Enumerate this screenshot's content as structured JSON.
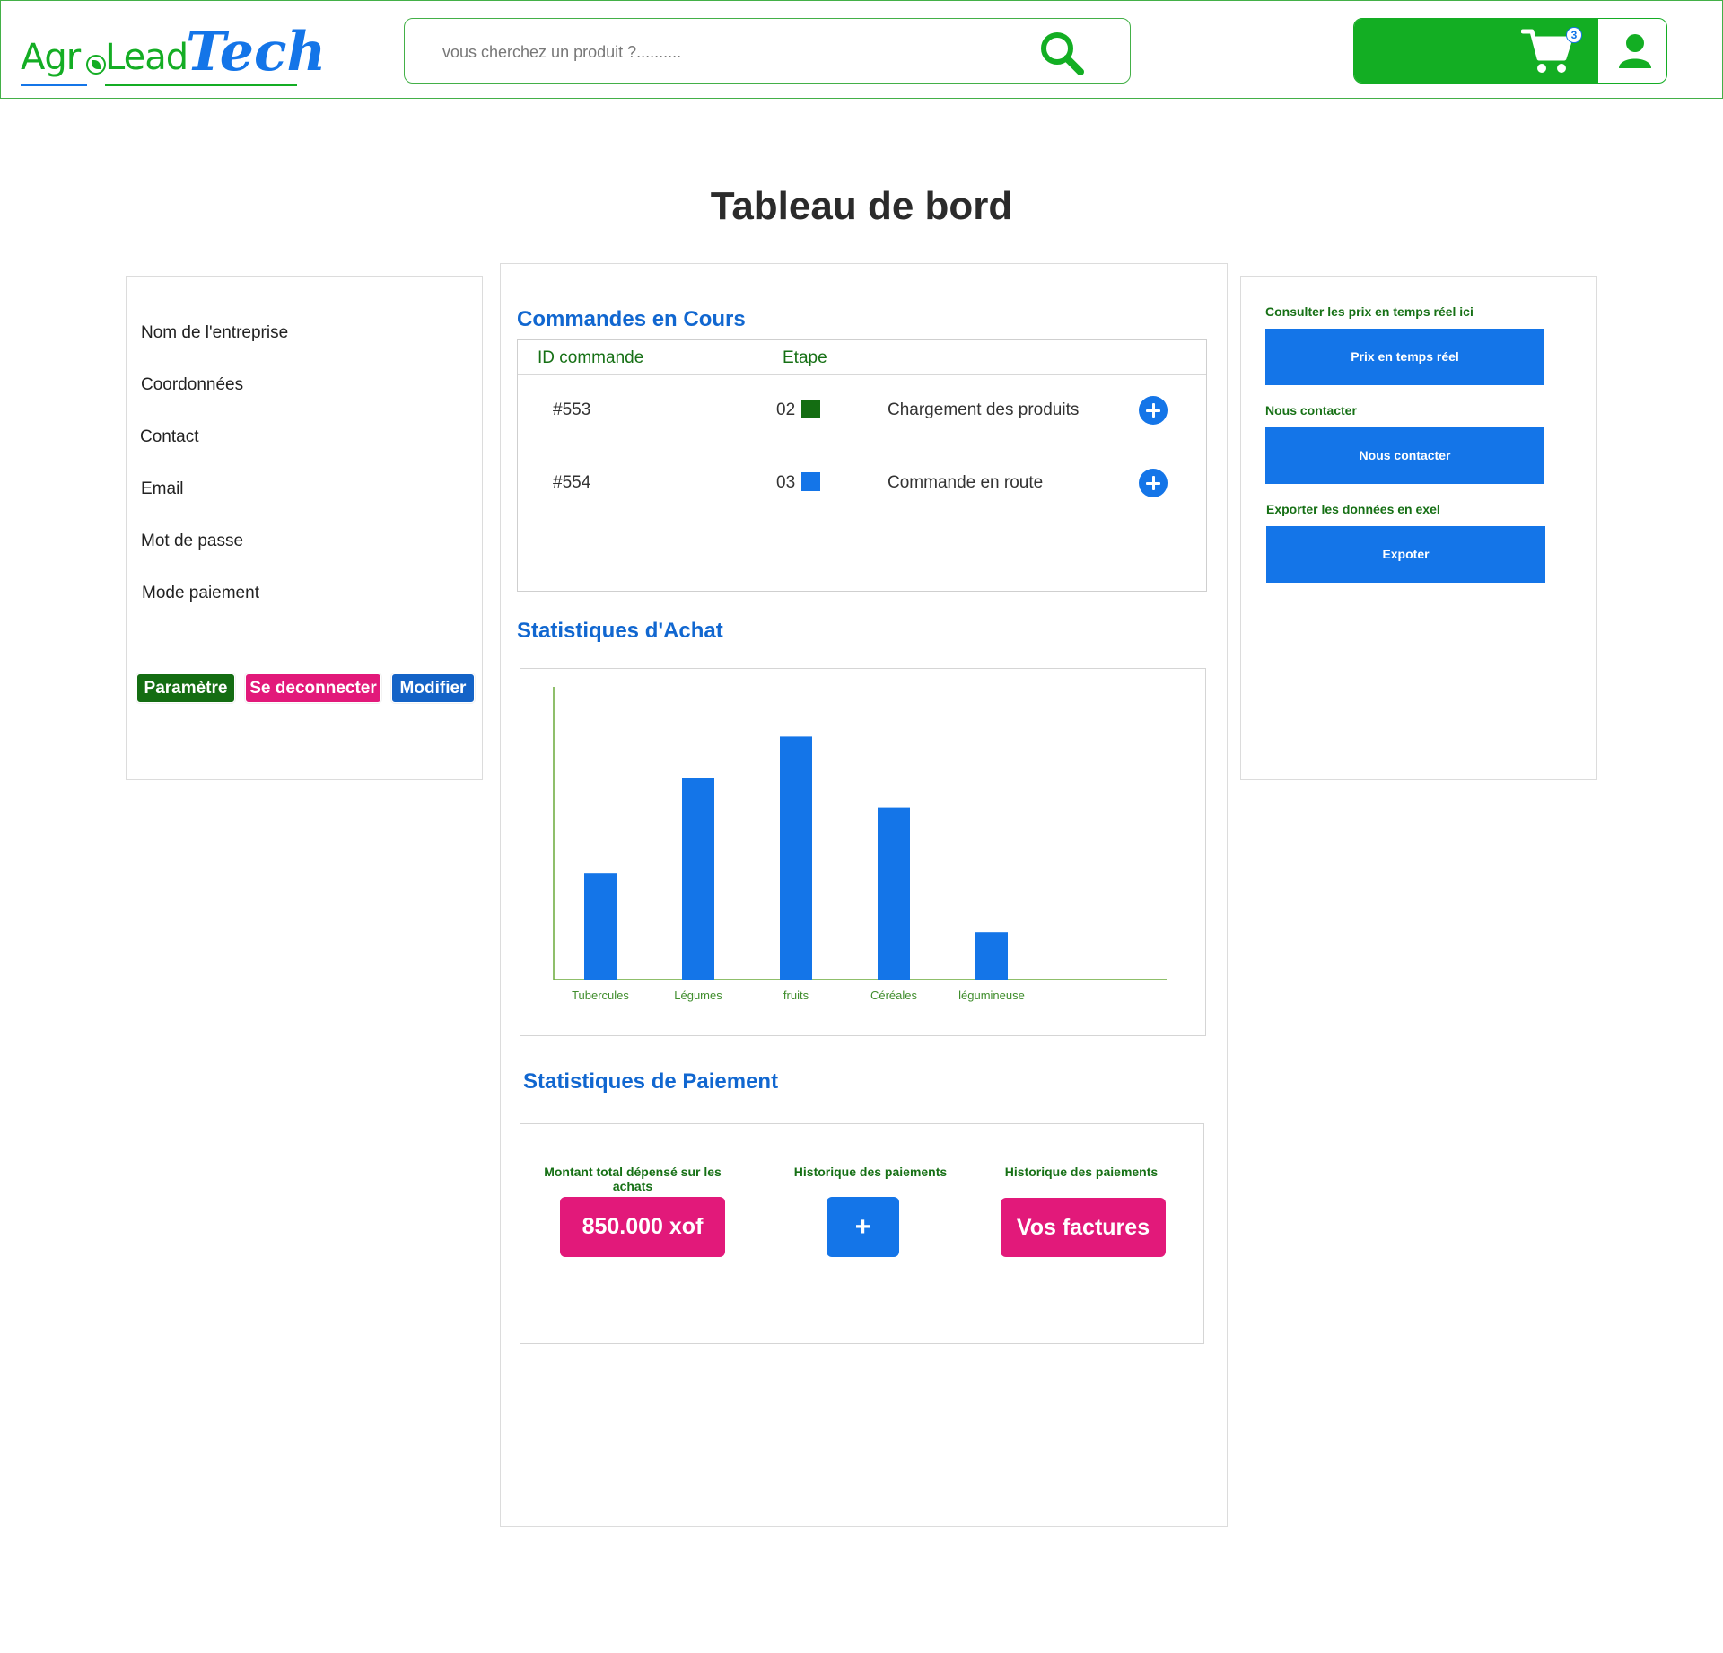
{
  "colors": {
    "brand_green": "#13ae23",
    "brand_blue": "#1475e8",
    "dark_green": "#167015",
    "pink": "#e2197a",
    "title_blue": "#1167d0"
  },
  "header": {
    "logo": {
      "agro": "Agr",
      "lead": "Lead",
      "tech": "Tech"
    },
    "search": {
      "placeholder": "vous cherchez un produit ?..........",
      "icon": "search-icon"
    },
    "cart": {
      "count": "3",
      "icon": "cart-icon"
    },
    "user": {
      "icon": "user-icon"
    }
  },
  "page": {
    "title": "Tableau de bord"
  },
  "sidebar": {
    "items": [
      {
        "label": "Nom de l'entreprise"
      },
      {
        "label": "Coordonnées"
      },
      {
        "label": "Contact"
      },
      {
        "label": "Email"
      },
      {
        "label": "Mot de passe"
      },
      {
        "label": "Mode paiement"
      }
    ],
    "buttons": {
      "settings": "Paramètre",
      "logout": "Se deconnecter",
      "edit": "Modifier"
    }
  },
  "orders": {
    "title": "Commandes en Cours",
    "columns": {
      "id": "ID commande",
      "step": "Etape"
    },
    "rows": [
      {
        "id": "#553",
        "step": "02",
        "step_color": "#146d12",
        "status": "Chargement des produits"
      },
      {
        "id": "#554",
        "step": "03",
        "step_color": "#1475e8",
        "status": "Commande en route"
      }
    ]
  },
  "purchases": {
    "title": "Statistiques d'Achat"
  },
  "chart_data": {
    "type": "bar",
    "categories": [
      "Tubercules",
      "Légumes",
      "fruits",
      "Céréales",
      "légumineuse"
    ],
    "values": [
      36,
      68,
      82,
      58,
      16
    ],
    "ylim": [
      0,
      100
    ],
    "bar_color": "#1475e8",
    "axis_color": "#6aaa3a",
    "grid": false,
    "title": "",
    "xlabel": "",
    "ylabel": ""
  },
  "payments": {
    "title": "Statistiques de Paiement",
    "total_label": "Montant total dépensé sur les achats",
    "total_value": "850.000 xof",
    "history_label": "Historique des paiements",
    "history_button": "+",
    "invoices_label": "Historique des paiements",
    "invoices_button": "Vos factures"
  },
  "right_panel": {
    "realtime_label": "Consulter les prix en temps réel ici",
    "realtime_button": "Prix en temps réel",
    "contact_label": "Nous contacter",
    "contact_button": "Nous contacter",
    "export_label": "Exporter les données en exel",
    "export_button": "Expoter"
  }
}
